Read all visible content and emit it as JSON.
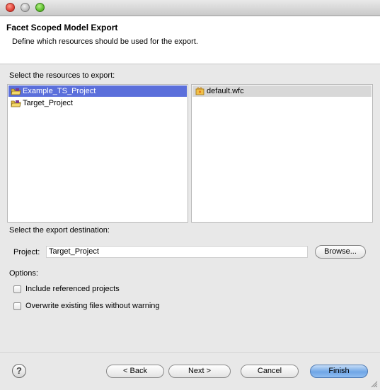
{
  "window": {
    "title": ""
  },
  "header": {
    "title": "Facet Scoped Model Export",
    "description": "Define which resources should be used for the export."
  },
  "resources": {
    "label": "Select the resources to export:",
    "projects": [
      {
        "name": "Example_TS_Project",
        "icon": "project-folder-icon",
        "selected": true
      },
      {
        "name": "Target_Project",
        "icon": "project-folder-icon",
        "selected": false
      }
    ],
    "files": [
      {
        "name": "default.wfc",
        "icon": "wfc-file-icon",
        "selected": true
      }
    ]
  },
  "destination": {
    "label": "Select the export destination:",
    "project_label": "Project:",
    "project_value": "Target_Project",
    "browse_label": "Browse..."
  },
  "options": {
    "label": "Options:",
    "include_referenced": {
      "label": "Include referenced projects",
      "checked": false
    },
    "overwrite": {
      "label": "Overwrite existing files without warning",
      "checked": false
    }
  },
  "footer": {
    "help": "?",
    "back": "< Back",
    "next": "Next >",
    "cancel": "Cancel",
    "finish": "Finish"
  },
  "colors": {
    "selection_active": "#5b6fdb",
    "selection_inactive": "#d8d8d8",
    "default_button": "#6fa6e6"
  }
}
